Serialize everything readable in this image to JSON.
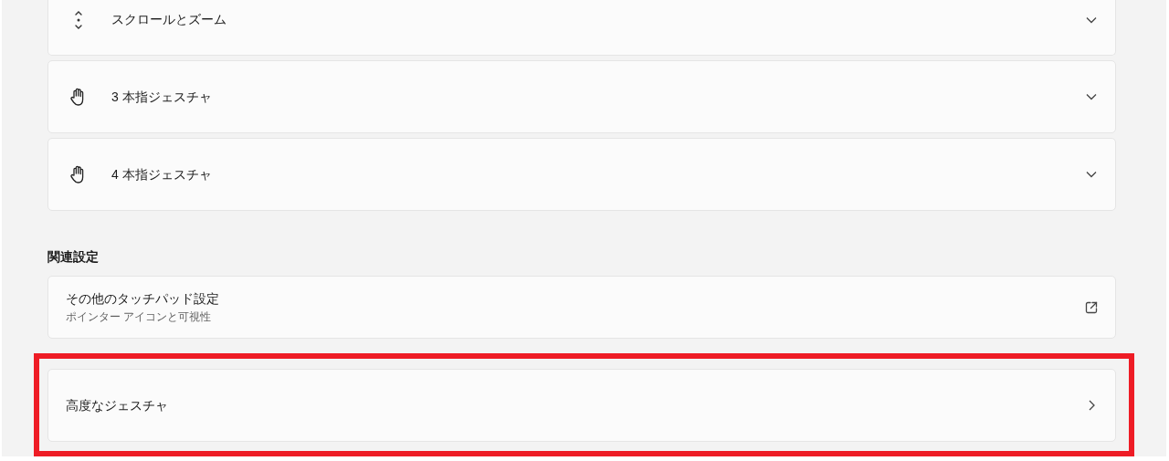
{
  "expanders": [
    {
      "kind": "scroll",
      "label": "スクロールとズーム",
      "expanded": false
    },
    {
      "kind": "hand",
      "label": "3 本指ジェスチャ",
      "expanded": false
    },
    {
      "kind": "hand",
      "label": "4 本指ジェスチャ",
      "expanded": false
    }
  ],
  "related": {
    "heading": "関連設定",
    "items": [
      {
        "kind": "external",
        "title": "その他のタッチパッド設定",
        "subtitle": "ポインター アイコンと可視性",
        "highlighted": false
      },
      {
        "kind": "navigate",
        "title": "高度なジェスチャ",
        "highlighted": true
      }
    ]
  }
}
